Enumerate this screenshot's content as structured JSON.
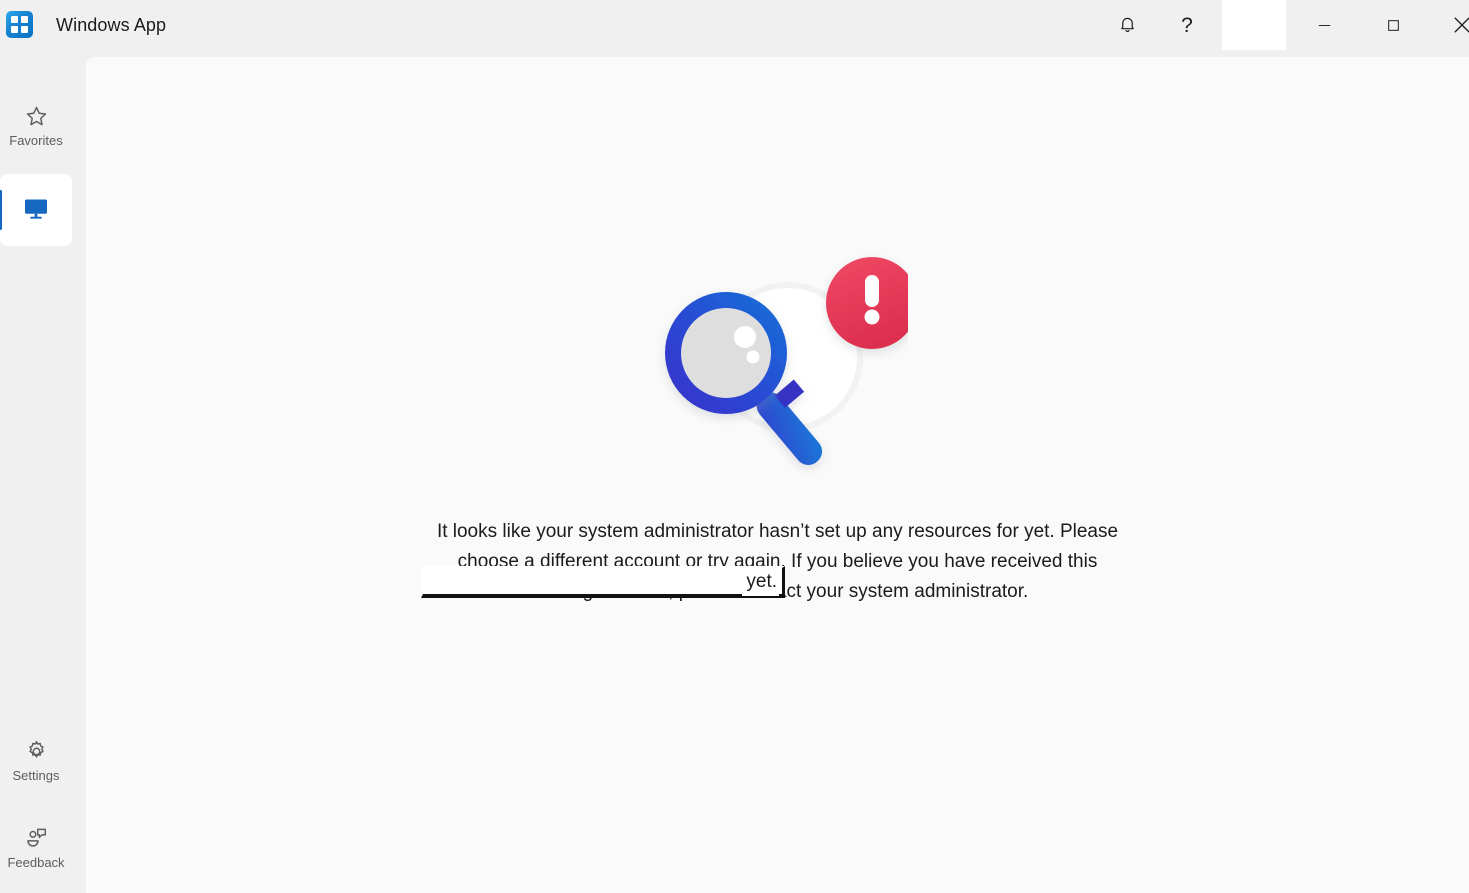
{
  "window": {
    "title": "Windows App",
    "app_icon": "windows-grid-icon",
    "brand_blue": "#1668c1",
    "titlebar_bg": "#f0f0f0",
    "content_bg": "#fafafa"
  },
  "titlebar_buttons": [
    {
      "name": "notifications",
      "icon": "bell-icon",
      "label": ""
    },
    {
      "name": "help",
      "icon": "question-mark-icon",
      "label": "?"
    },
    {
      "name": "account",
      "icon": "account-redacted",
      "label": ""
    },
    {
      "name": "minimize",
      "icon": "minimize-icon",
      "label": ""
    },
    {
      "name": "maximize",
      "icon": "maximize-icon",
      "label": ""
    },
    {
      "name": "close",
      "icon": "close-icon",
      "label": ""
    }
  ],
  "sidebar": {
    "items": [
      {
        "label": "Favorites",
        "icon": "star-icon",
        "selected": false
      },
      {
        "label": "",
        "icon": "monitor-icon",
        "selected": true
      },
      {
        "label": "Settings",
        "icon": "gear-icon",
        "selected": false
      },
      {
        "label": "Feedback",
        "icon": "feedback-person-icon",
        "selected": false
      }
    ]
  },
  "main": {
    "illustration": {
      "name": "magnifier-error-illustration",
      "magnifier_color": "#2457d6",
      "lens_color": "#dddddd",
      "badge_color": "#e8445f",
      "badge_glyph": "!"
    },
    "message_line1": "It looks like your system administrator hasn’t set up any resources for",
    "message_rest": "yet. Please choose a different account or try again. If you believe you have received this message in error, please contact your system administrator.",
    "message_full": "It looks like your system administrator hasn’t set up any resources for yet. Please choose a different account or try again. If you believe you have received this message in error, please contact your system administrator.",
    "redacted_word": "yet."
  }
}
